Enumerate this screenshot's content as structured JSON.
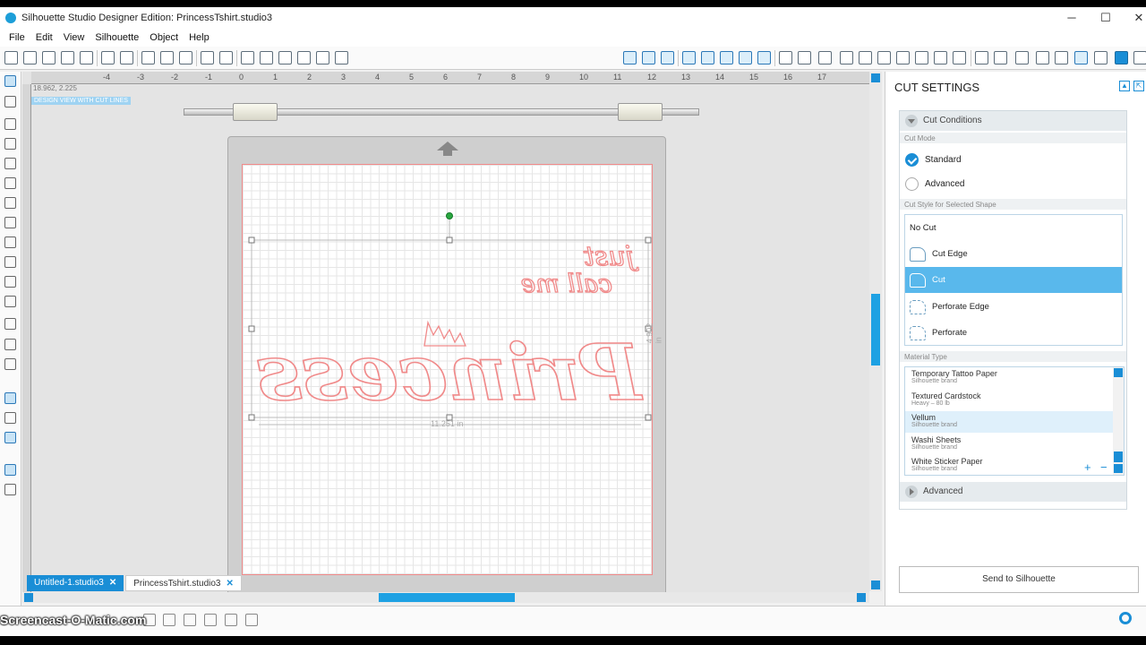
{
  "window": {
    "title": "Silhouette Studio Designer Edition: PrincessTshirt.studio3",
    "minimize": "─",
    "maximize": "☐",
    "close": "✕"
  },
  "menu": [
    "File",
    "Edit",
    "View",
    "Silhouette",
    "Object",
    "Help"
  ],
  "canvas": {
    "coords": "18.962, 2.225",
    "view_badge": "DESIGN VIEW WITH CUT LINES",
    "ruler_numbers": [
      "-4",
      "-3",
      "-2",
      "-1",
      "0",
      "1",
      "2",
      "3",
      "4",
      "5",
      "6",
      "7",
      "8",
      "9",
      "10",
      "11",
      "12",
      "13",
      "14",
      "15",
      "16",
      "17"
    ],
    "width_label": "11.251 in",
    "height_label": "4.902 in",
    "design_text_top": "just",
    "design_text_mid": "call me",
    "design_text_main": "Princess"
  },
  "doc_tabs": [
    {
      "label": "Untitled-1.studio3",
      "close": "✕"
    },
    {
      "label": "PrincessTshirt.studio3",
      "close": "✕"
    }
  ],
  "watermark": "Screencast-O-Matic.com",
  "panel": {
    "title": "CUT SETTINGS",
    "cut_conditions": "Cut Conditions",
    "cut_mode_label": "Cut Mode",
    "mode_standard": "Standard",
    "mode_advanced": "Advanced",
    "cut_style_label": "Cut Style for Selected Shape",
    "styles": [
      "No Cut",
      "Cut Edge",
      "Cut",
      "Perforate Edge",
      "Perforate"
    ],
    "selected_style": "Cut",
    "material_type_label": "Material Type",
    "materials": [
      {
        "name": "Temporary Tattoo Paper",
        "brand": "Silhouette brand"
      },
      {
        "name": "Textured Cardstock",
        "brand": "Heavy – 80 lb"
      },
      {
        "name": "Vellum",
        "brand": "Silhouette brand"
      },
      {
        "name": "Washi Sheets",
        "brand": "Silhouette brand"
      },
      {
        "name": "White Sticker Paper",
        "brand": "Silhouette brand"
      }
    ],
    "highlighted_material": "Vellum",
    "advanced": "Advanced",
    "send_button": "Send to Silhouette",
    "add": "+",
    "remove": "−"
  },
  "colors": {
    "accent": "#1a8ed6",
    "cut_line": "#f08a8a",
    "selected_row": "#59b8ec"
  }
}
